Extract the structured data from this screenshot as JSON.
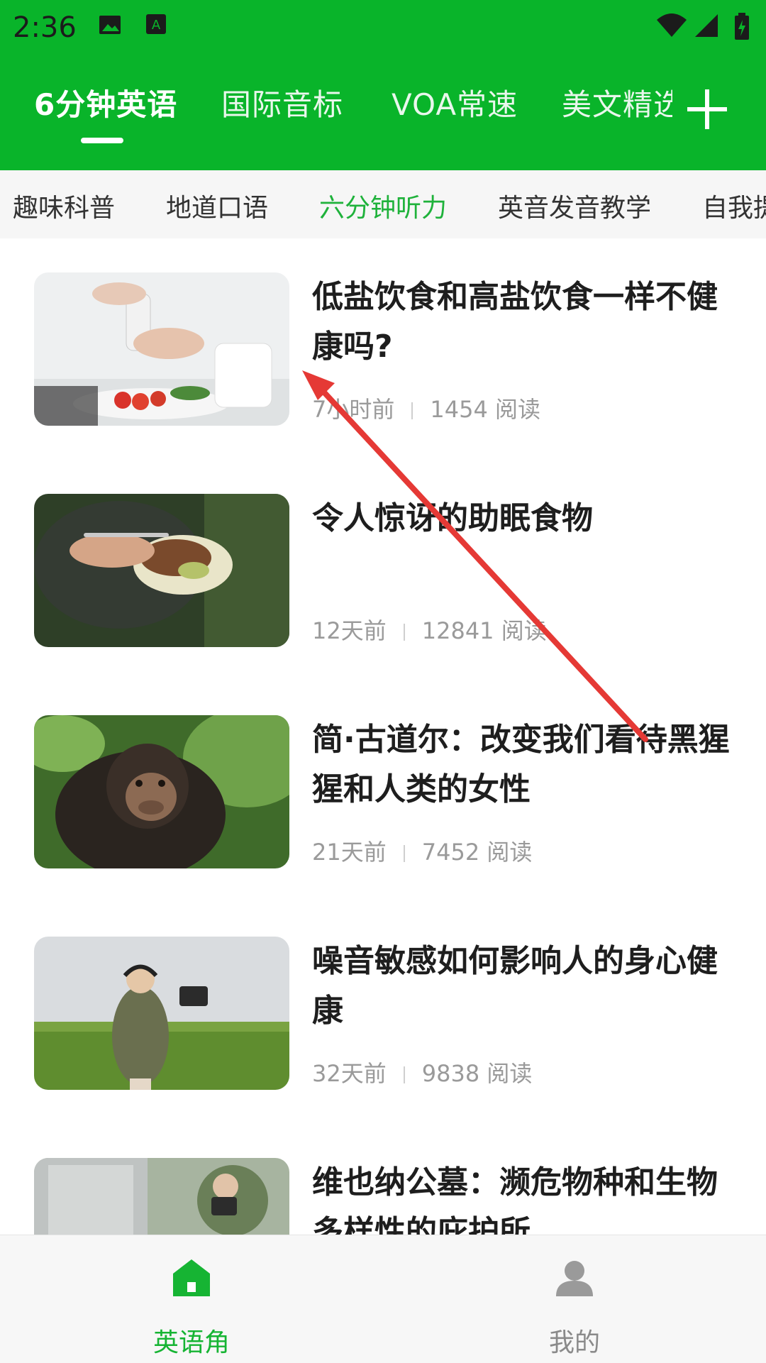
{
  "status_bar": {
    "time": "2:36"
  },
  "top_tabs": [
    {
      "label": "6分钟英语",
      "active": true
    },
    {
      "label": "国际音标",
      "active": false
    },
    {
      "label": "VOA常速",
      "active": false
    },
    {
      "label": "美文精选",
      "active": false
    }
  ],
  "sub_tabs": [
    {
      "label": "趣味科普",
      "active": false
    },
    {
      "label": "地道口语",
      "active": false
    },
    {
      "label": "六分钟听力",
      "active": true
    },
    {
      "label": "英音发音教学",
      "active": false
    },
    {
      "label": "自我提",
      "active": false
    }
  ],
  "articles": [
    {
      "title": "低盐饮食和高盐饮食一样不健康吗?",
      "time": "7小时前",
      "reads": "1454 阅读"
    },
    {
      "title": "令人惊讶的助眠食物",
      "time": "12天前",
      "reads": "12841 阅读"
    },
    {
      "title": "简·古道尔：改变我们看待黑猩猩和人类的女性",
      "time": "21天前",
      "reads": "7452 阅读"
    },
    {
      "title": "噪音敏感如何影响人的身心健康",
      "time": "32天前",
      "reads": "9838 阅读"
    },
    {
      "title": "维也纳公墓：濒危物种和生物多样性的庇护所",
      "time": "",
      "reads": ""
    }
  ],
  "bottom_nav": [
    {
      "label": "英语角",
      "icon": "home-icon",
      "active": true
    },
    {
      "label": "我的",
      "icon": "person-icon",
      "active": false
    }
  ],
  "colors": {
    "brand_green": "#09b42a",
    "subtab_active": "#1fb23b",
    "arrow_red": "#e53935"
  }
}
